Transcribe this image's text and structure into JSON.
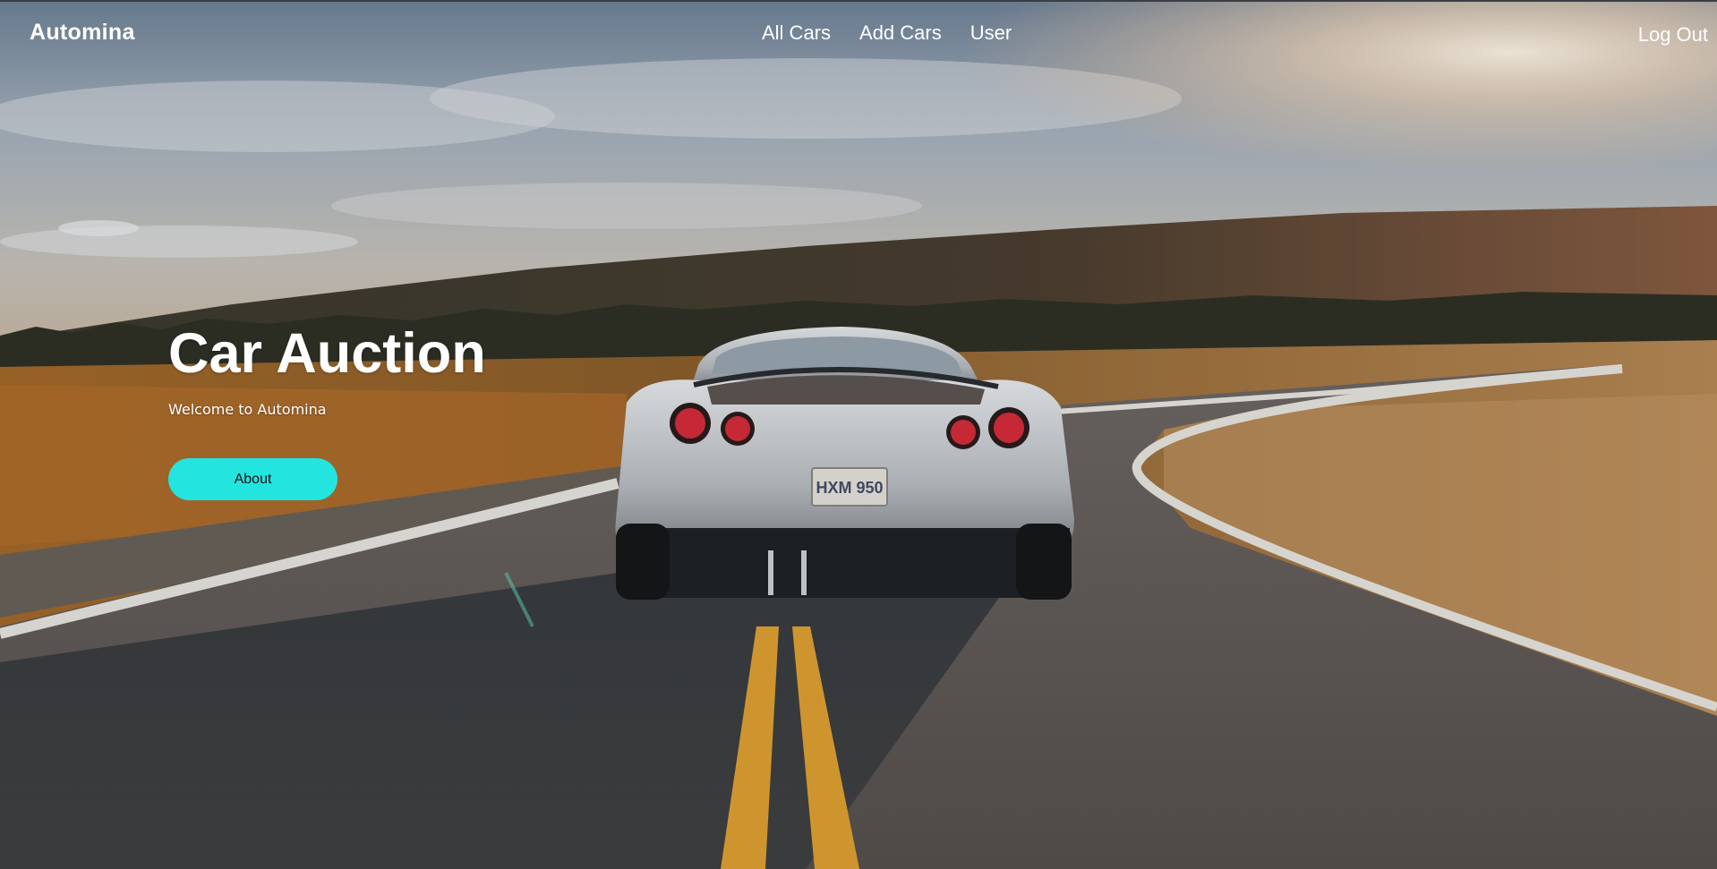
{
  "nav": {
    "brand": "Automina",
    "links": [
      {
        "label": "All Cars"
      },
      {
        "label": "Add Cars"
      },
      {
        "label": "User"
      }
    ],
    "logout_label": "Log Out"
  },
  "hero": {
    "title": "Car Auction",
    "subtitle": "Welcome to Automina",
    "button_label": "About",
    "button_color": "#24e4e0",
    "plate_text": "HXM 950"
  }
}
